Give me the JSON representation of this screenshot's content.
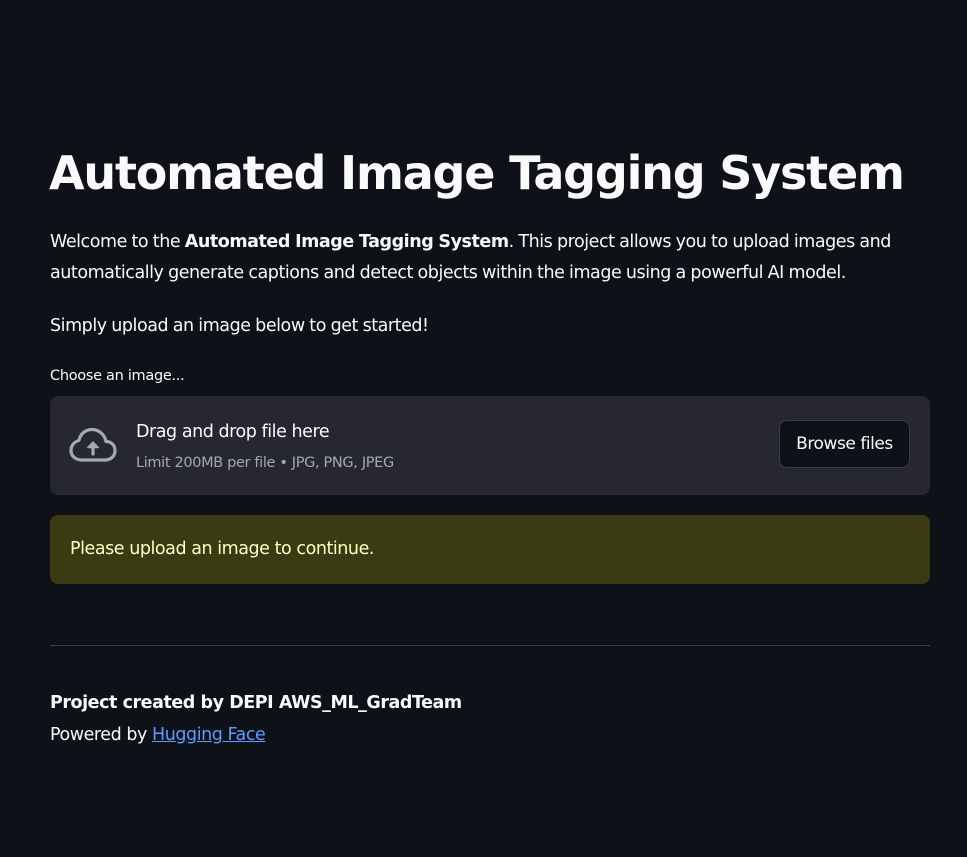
{
  "header": {
    "title": "Automated Image Tagging System"
  },
  "intro": {
    "prefix": "Welcome to the ",
    "bold": "Automated Image Tagging System",
    "suffix": ". This project allows you to upload images and automatically generate captions and detect objects within the image using a powerful AI model.",
    "cta": "Simply upload an image below to get started!"
  },
  "uploader": {
    "label": "Choose an image...",
    "drop_title": "Drag and drop file here",
    "limit_text": "Limit 200MB per file • JPG, PNG, JPEG",
    "browse_label": "Browse files",
    "icon": "cloud-upload-icon"
  },
  "alert": {
    "text": "Please upload an image to continue.",
    "background": "#3a3a13",
    "text_color": "#ffffc2"
  },
  "footer": {
    "credit": "Project created by DEPI AWS_ML_GradTeam",
    "powered_prefix": "Powered by ",
    "powered_link": "Hugging Face",
    "link_color": "#5a9cff"
  },
  "colors": {
    "background": "#0e1117",
    "dropzone": "#262730",
    "text": "#fafafa"
  }
}
